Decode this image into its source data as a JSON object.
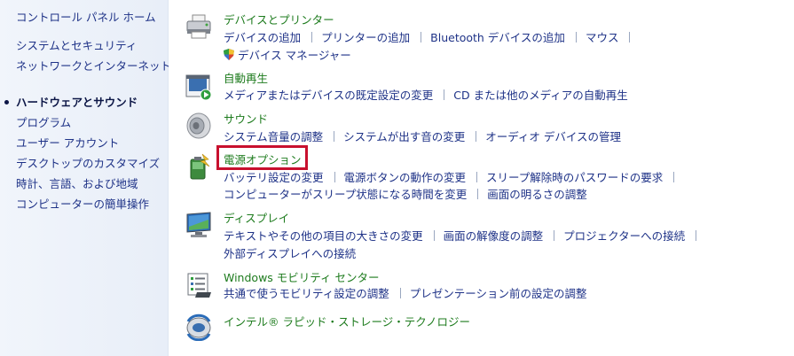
{
  "sidebar": {
    "home": "コントロール パネル ホーム",
    "items": [
      {
        "label": "システムとセキュリティ"
      },
      {
        "label": "ネットワークとインターネット"
      },
      {
        "label": "ハードウェアとサウンド"
      },
      {
        "label": "プログラム"
      },
      {
        "label": "ユーザー アカウント"
      },
      {
        "label": "デスクトップのカスタマイズ"
      },
      {
        "label": "時計、言語、および地域"
      },
      {
        "label": "コンピューターの簡単操作"
      }
    ]
  },
  "categories": [
    {
      "title": "デバイスとプリンター",
      "icon": "printer-icon",
      "rows": [
        [
          "デバイスの追加",
          "プリンターの追加",
          "Bluetooth デバイスの追加",
          "マウス"
        ],
        [
          "デバイス マネージャー"
        ]
      ]
    },
    {
      "title": "自動再生",
      "icon": "autoplay-icon",
      "rows": [
        [
          "メディアまたはデバイスの既定設定の変更",
          "CD または他のメディアの自動再生"
        ]
      ]
    },
    {
      "title": "サウンド",
      "icon": "speaker-icon",
      "rows": [
        [
          "システム音量の調整",
          "システムが出す音の変更",
          "オーディオ デバイスの管理"
        ]
      ]
    },
    {
      "title": "電源オプション",
      "icon": "battery-icon",
      "rows": [
        [
          "バッテリ設定の変更",
          "電源ボタンの動作の変更",
          "スリープ解除時のパスワードの要求"
        ],
        [
          "コンピューターがスリープ状態になる時間を変更",
          "画面の明るさの調整"
        ]
      ]
    },
    {
      "title": "ディスプレイ",
      "icon": "display-icon",
      "rows": [
        [
          "テキストやその他の項目の大きさの変更",
          "画面の解像度の調整",
          "プロジェクターへの接続"
        ],
        [
          "外部ディスプレイへの接続"
        ]
      ]
    },
    {
      "title": "Windows モビリティ センター",
      "icon": "mobility-center-icon",
      "rows": [
        [
          "共通で使うモビリティ設定の調整",
          "プレゼンテーション前の設定の調整"
        ]
      ]
    },
    {
      "title": "インテル® ラピッド・ストレージ・テクノロジー",
      "icon": "intel-rst-icon",
      "rows": []
    }
  ],
  "colors": {
    "category_title": "#1d7b1d",
    "link": "#1e3287",
    "highlight_box": "#c8102e"
  }
}
